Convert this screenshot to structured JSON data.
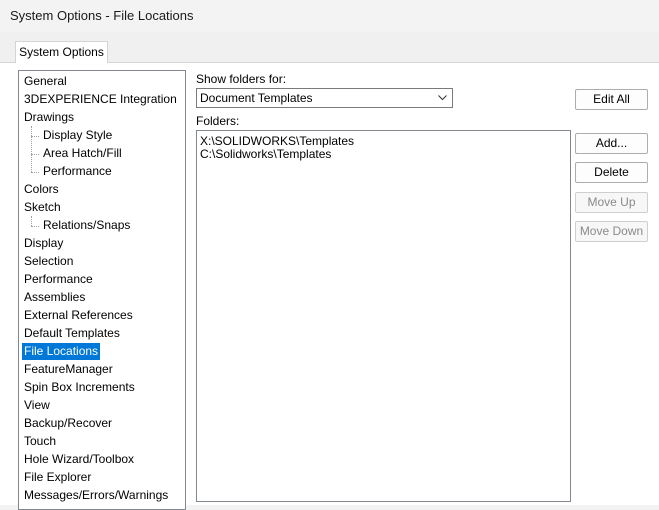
{
  "window": {
    "title": "System Options - File Locations"
  },
  "tabs": [
    {
      "label": "System Options"
    }
  ],
  "tree": {
    "items": [
      {
        "label": "General",
        "level": 0
      },
      {
        "label": "3DEXPERIENCE Integration",
        "level": 0
      },
      {
        "label": "Drawings",
        "level": 0
      },
      {
        "label": "Display Style",
        "level": 1
      },
      {
        "label": "Area Hatch/Fill",
        "level": 1
      },
      {
        "label": "Performance",
        "level": 1
      },
      {
        "label": "Colors",
        "level": 0
      },
      {
        "label": "Sketch",
        "level": 0
      },
      {
        "label": "Relations/Snaps",
        "level": 1
      },
      {
        "label": "Display",
        "level": 0
      },
      {
        "label": "Selection",
        "level": 0
      },
      {
        "label": "Performance",
        "level": 0
      },
      {
        "label": "Assemblies",
        "level": 0
      },
      {
        "label": "External References",
        "level": 0
      },
      {
        "label": "Default Templates",
        "level": 0
      },
      {
        "label": "File Locations",
        "level": 0,
        "selected": true
      },
      {
        "label": "FeatureManager",
        "level": 0
      },
      {
        "label": "Spin Box Increments",
        "level": 0
      },
      {
        "label": "View",
        "level": 0
      },
      {
        "label": "Backup/Recover",
        "level": 0
      },
      {
        "label": "Touch",
        "level": 0
      },
      {
        "label": "Hole Wizard/Toolbox",
        "level": 0
      },
      {
        "label": "File Explorer",
        "level": 0
      },
      {
        "label": "Messages/Errors/Warnings",
        "level": 0
      }
    ]
  },
  "show_folders": {
    "label": "Show folders for:",
    "selected": "Document Templates"
  },
  "folders": {
    "label": "Folders:",
    "items": [
      "X:\\SOLIDWORKS\\Templates",
      "C:\\Solidworks\\Templates"
    ]
  },
  "buttons": {
    "edit_all": "Edit All",
    "add": "Add...",
    "delete": "Delete",
    "move_up": "Move Up",
    "move_down": "Move Down"
  },
  "colors": {
    "selection": "#0078d7"
  }
}
